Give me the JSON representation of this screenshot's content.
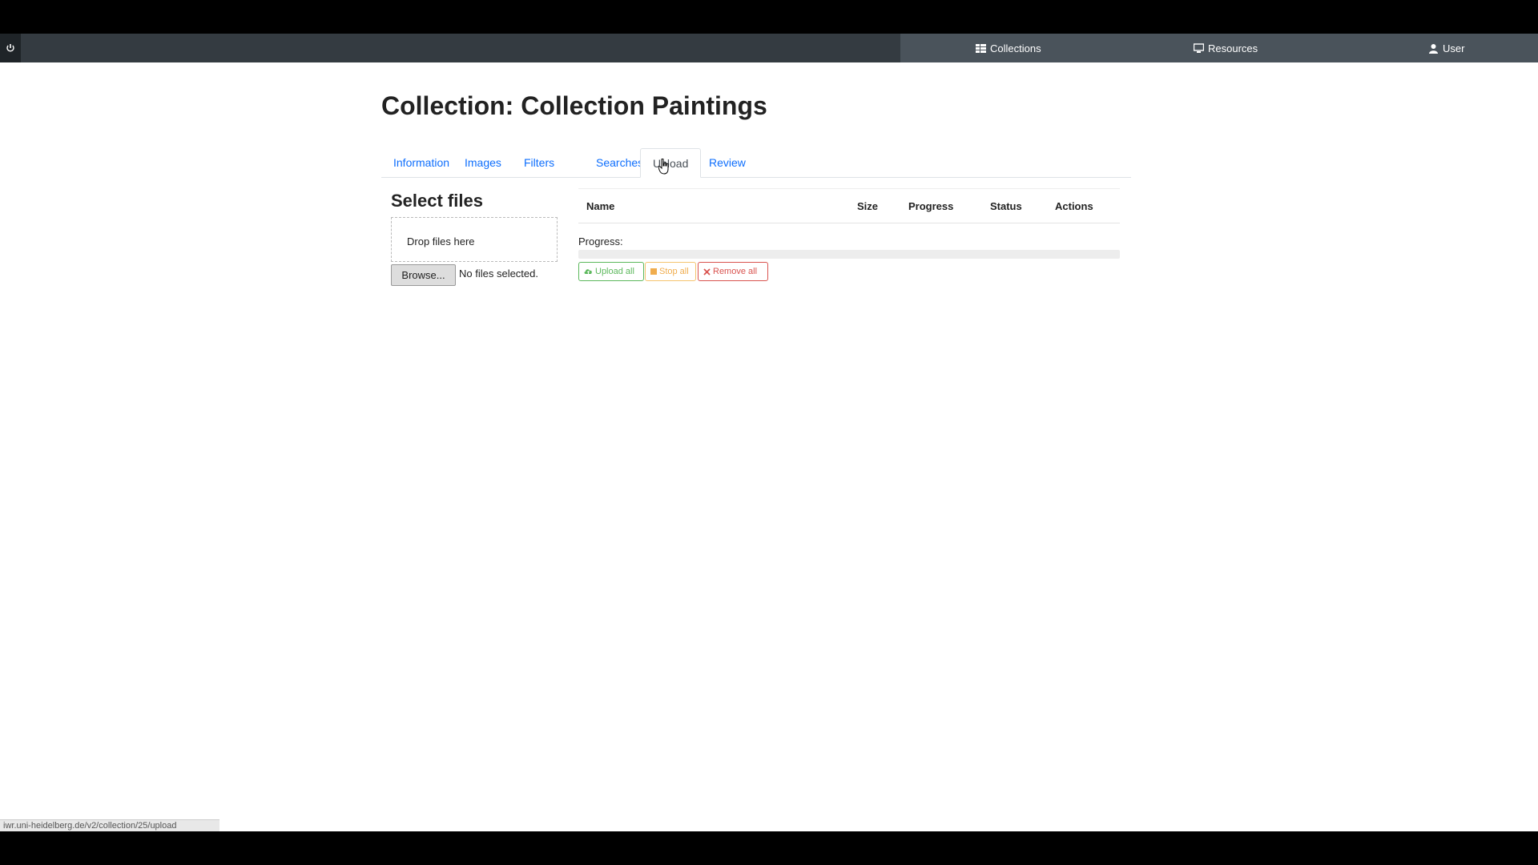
{
  "navbar": {
    "items": [
      {
        "label": "Collections",
        "icon": "list-icon"
      },
      {
        "label": "Resources",
        "icon": "monitor-icon"
      },
      {
        "label": "User",
        "icon": "user-icon"
      }
    ]
  },
  "page": {
    "title": "Collection: Collection Paintings",
    "tabs": [
      {
        "label": "Information"
      },
      {
        "label": "Images"
      },
      {
        "label": "Filters"
      },
      {
        "label": "Searches"
      },
      {
        "label": "Upload",
        "active": true
      },
      {
        "label": "Review"
      }
    ]
  },
  "upload": {
    "select_title": "Select files",
    "dropzone_text": "Drop files here",
    "browse_label": "Browse...",
    "no_files_text": "No files selected.",
    "table_headers": [
      "Name",
      "Size",
      "Progress",
      "Status",
      "Actions"
    ],
    "progress_label": "Progress:",
    "progress_value": 0,
    "buttons": {
      "upload_all": "Upload all",
      "stop_all": "Stop all",
      "remove_all": "Remove all"
    }
  },
  "statusbar": {
    "url": "iwr.uni-heidelberg.de/v2/collection/25/upload"
  },
  "colors": {
    "navbar": "#343b41",
    "navbar_right": "#4a535b",
    "link": "#0d6efd",
    "success": "#5cb85c",
    "warning": "#f0ad4e",
    "danger": "#d9534f"
  }
}
